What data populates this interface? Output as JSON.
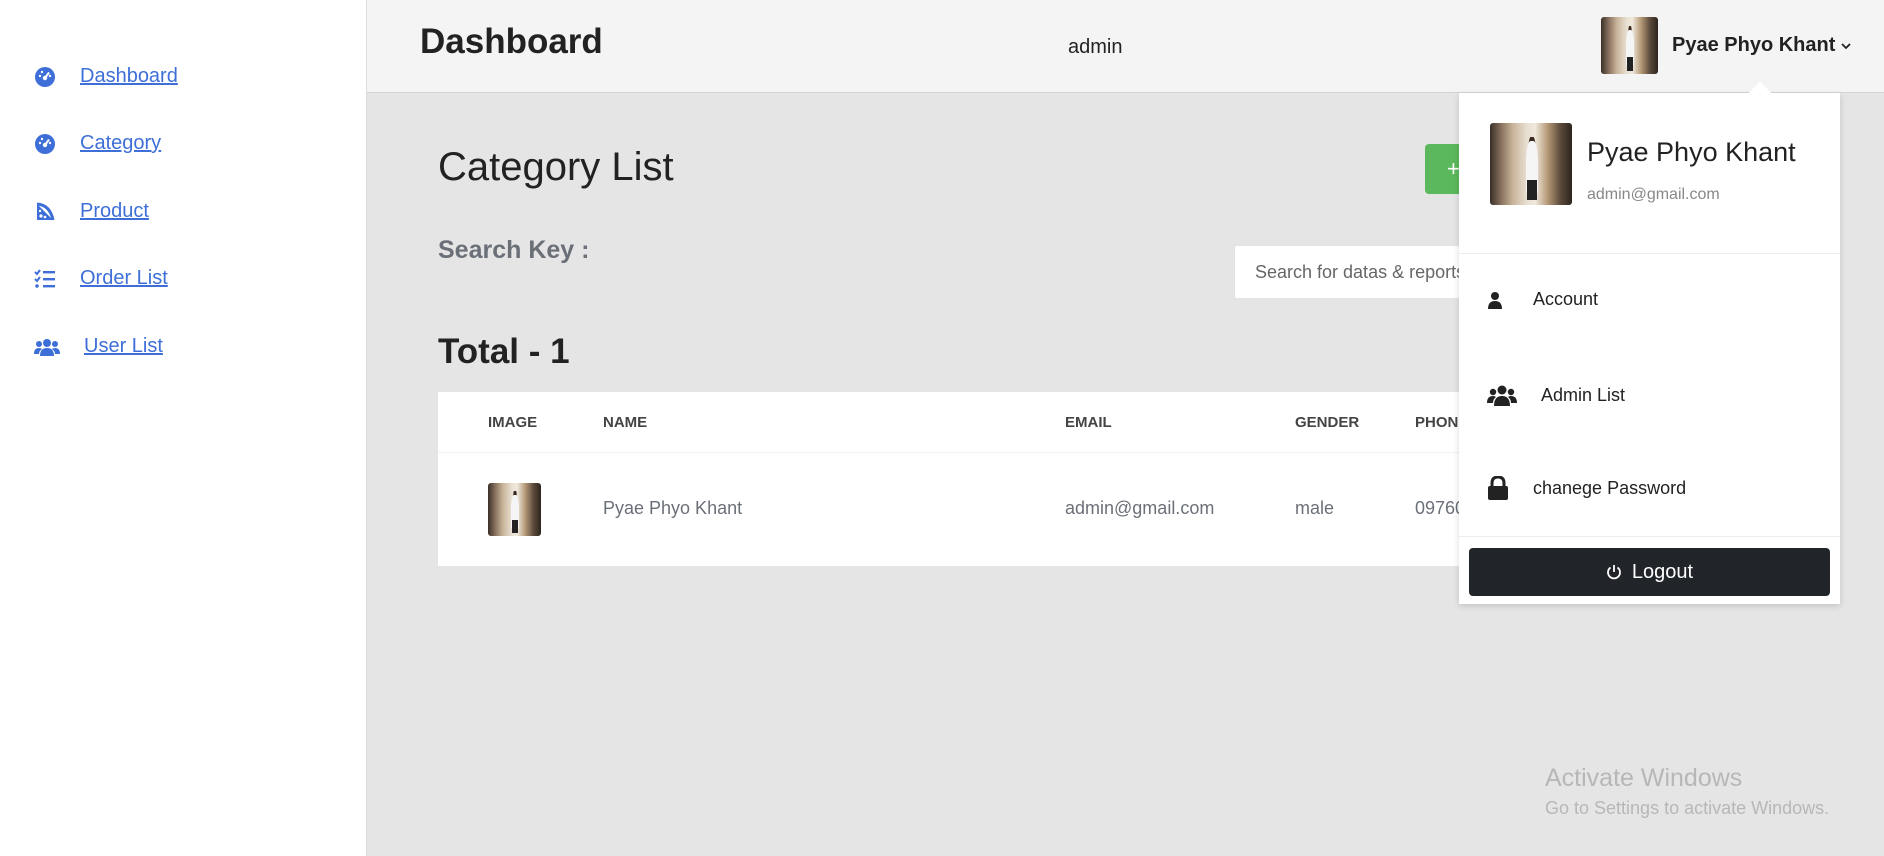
{
  "header": {
    "title": "Dashboard",
    "role": "admin",
    "user_name": "Pyae Phyo Khant"
  },
  "sidebar": {
    "items": [
      {
        "label": "Dashboard",
        "icon": "gauge-icon"
      },
      {
        "label": "Category",
        "icon": "gauge-icon"
      },
      {
        "label": "Product",
        "icon": "pizza-icon"
      },
      {
        "label": "Order List",
        "icon": "list-check-icon"
      },
      {
        "label": "User List",
        "icon": "users-icon"
      }
    ]
  },
  "main": {
    "title": "Category List",
    "search_label": "Search Key :",
    "search_placeholder": "Search for datas & reports",
    "add_button": "+",
    "total": "Total - 1"
  },
  "table": {
    "columns": [
      "IMAGE",
      "NAME",
      "EMAIL",
      "GENDER",
      "PHON"
    ],
    "rows": [
      {
        "name": "Pyae Phyo Khant",
        "email": "admin@gmail.com",
        "gender": "male",
        "phone": "09760"
      }
    ]
  },
  "dropdown": {
    "name": "Pyae Phyo Khant",
    "email": "admin@gmail.com",
    "items": [
      {
        "label": "Account",
        "icon": "user-icon"
      },
      {
        "label": "Admin List",
        "icon": "users-icon"
      },
      {
        "label": "chanege Password",
        "icon": "lock-icon"
      }
    ],
    "logout": "Logout"
  },
  "watermark": {
    "title": "Activate Windows",
    "subtitle": "Go to Settings to activate Windows."
  },
  "colors": {
    "link": "#3e6fd8",
    "add_button": "#5cb85c",
    "logout_button": "#212529"
  }
}
